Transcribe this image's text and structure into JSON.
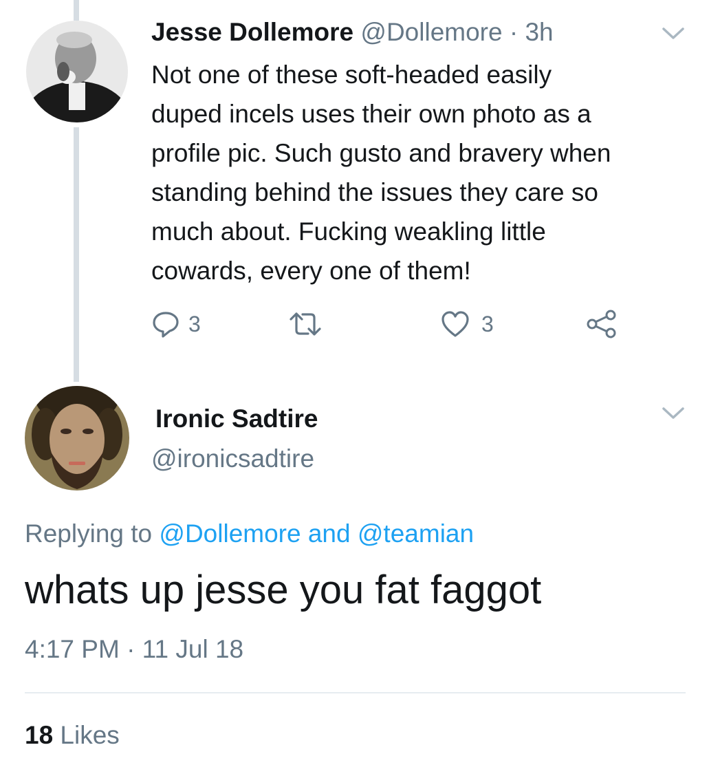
{
  "tweet1": {
    "author_name": "Jesse Dollemore",
    "handle": "@Dollemore",
    "separator": " · ",
    "time": "3h",
    "text": "Not one of these soft-headed easily\nduped incels uses their own photo as a\nprofile pic. Such gusto and bravery when\nstanding behind the issues they care so\nmuch about. Fucking weakling little\ncowards, every one of them!",
    "reply_count": "3",
    "like_count": "3"
  },
  "tweet2": {
    "author_name": "Ironic Sadtire",
    "handle": "@ironicsadtire",
    "replying_prefix": "Replying to ",
    "reply_user1": "@Dollemore",
    "reply_and": " and ",
    "reply_user2": "@teamian",
    "text": "whats up jesse you fat faggot",
    "timestamp": "4:17 PM · 11 Jul 18",
    "likes_count": "18",
    "likes_label": " Likes"
  },
  "icons": {
    "reply": "reply-icon",
    "retweet": "retweet-icon",
    "like": "heart-icon",
    "share": "share-icon",
    "menu": "chevron-down-icon"
  },
  "colors": {
    "text": "#14171a",
    "secondary": "#657786",
    "link": "#1da1f2",
    "thread_line": "#d6dde3",
    "divider": "#e6ecf0"
  }
}
